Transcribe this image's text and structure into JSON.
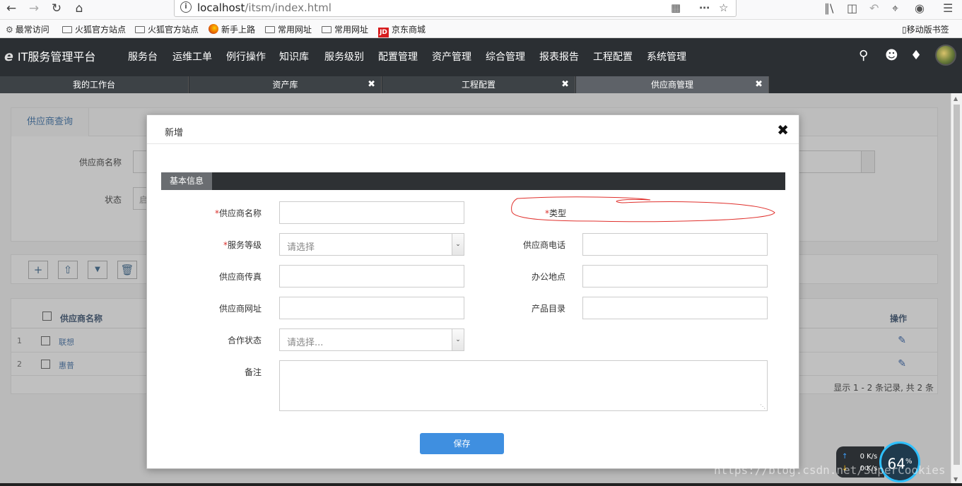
{
  "browser": {
    "url_host": "localhost",
    "url_path": "/itsm/index.html",
    "bookmarks": [
      "最常访问",
      "火狐官方站点",
      "火狐官方站点",
      "新手上路",
      "常用网址",
      "常用网址",
      "京东商城"
    ],
    "mobile_bookmarks": "移动版书签",
    "jd_badge": "JD"
  },
  "app": {
    "title": "IT服务管理平台",
    "menu": [
      "服务台",
      "运维工单",
      "例行操作",
      "知识库",
      "服务级别",
      "配置管理",
      "资产管理",
      "综合管理",
      "报表报告",
      "工程配置",
      "系统管理"
    ]
  },
  "tabs": [
    {
      "label": "我的工作台"
    },
    {
      "label": "资产库"
    },
    {
      "label": "工程配置"
    },
    {
      "label": "供应商管理"
    }
  ],
  "background": {
    "panel_tab": "供应商查询",
    "filter_name_label": "供应商名称",
    "filter_status_label": "状态",
    "filter_status_value": "启",
    "col_name": "供应商名称",
    "col_action": "操作",
    "rows": [
      {
        "index": "1",
        "name": "联想"
      },
      {
        "index": "2",
        "name": "惠普"
      }
    ],
    "pager": "显示 1 - 2 条记录, 共 2 条"
  },
  "modal": {
    "title": "新增",
    "section": "基本信息",
    "fields": {
      "supplier_name": "供应商名称",
      "type": "类型",
      "service_level": "服务等级",
      "service_level_placeholder": "请选择",
      "phone": "供应商电话",
      "fax": "供应商传真",
      "office": "办公地点",
      "website": "供应商网址",
      "catalog": "产品目录",
      "coop_status": "合作状态",
      "coop_status_placeholder": "请选择...",
      "remark": "备注"
    },
    "save": "保存"
  },
  "netspeed": {
    "up": "0 K/s",
    "down": "0 K/s",
    "percent": "64"
  },
  "watermark": "https://blog.csdn.net/SuperCookies",
  "colors": {
    "annotation": "#e0302c",
    "save_button": "#3f8fe0"
  }
}
